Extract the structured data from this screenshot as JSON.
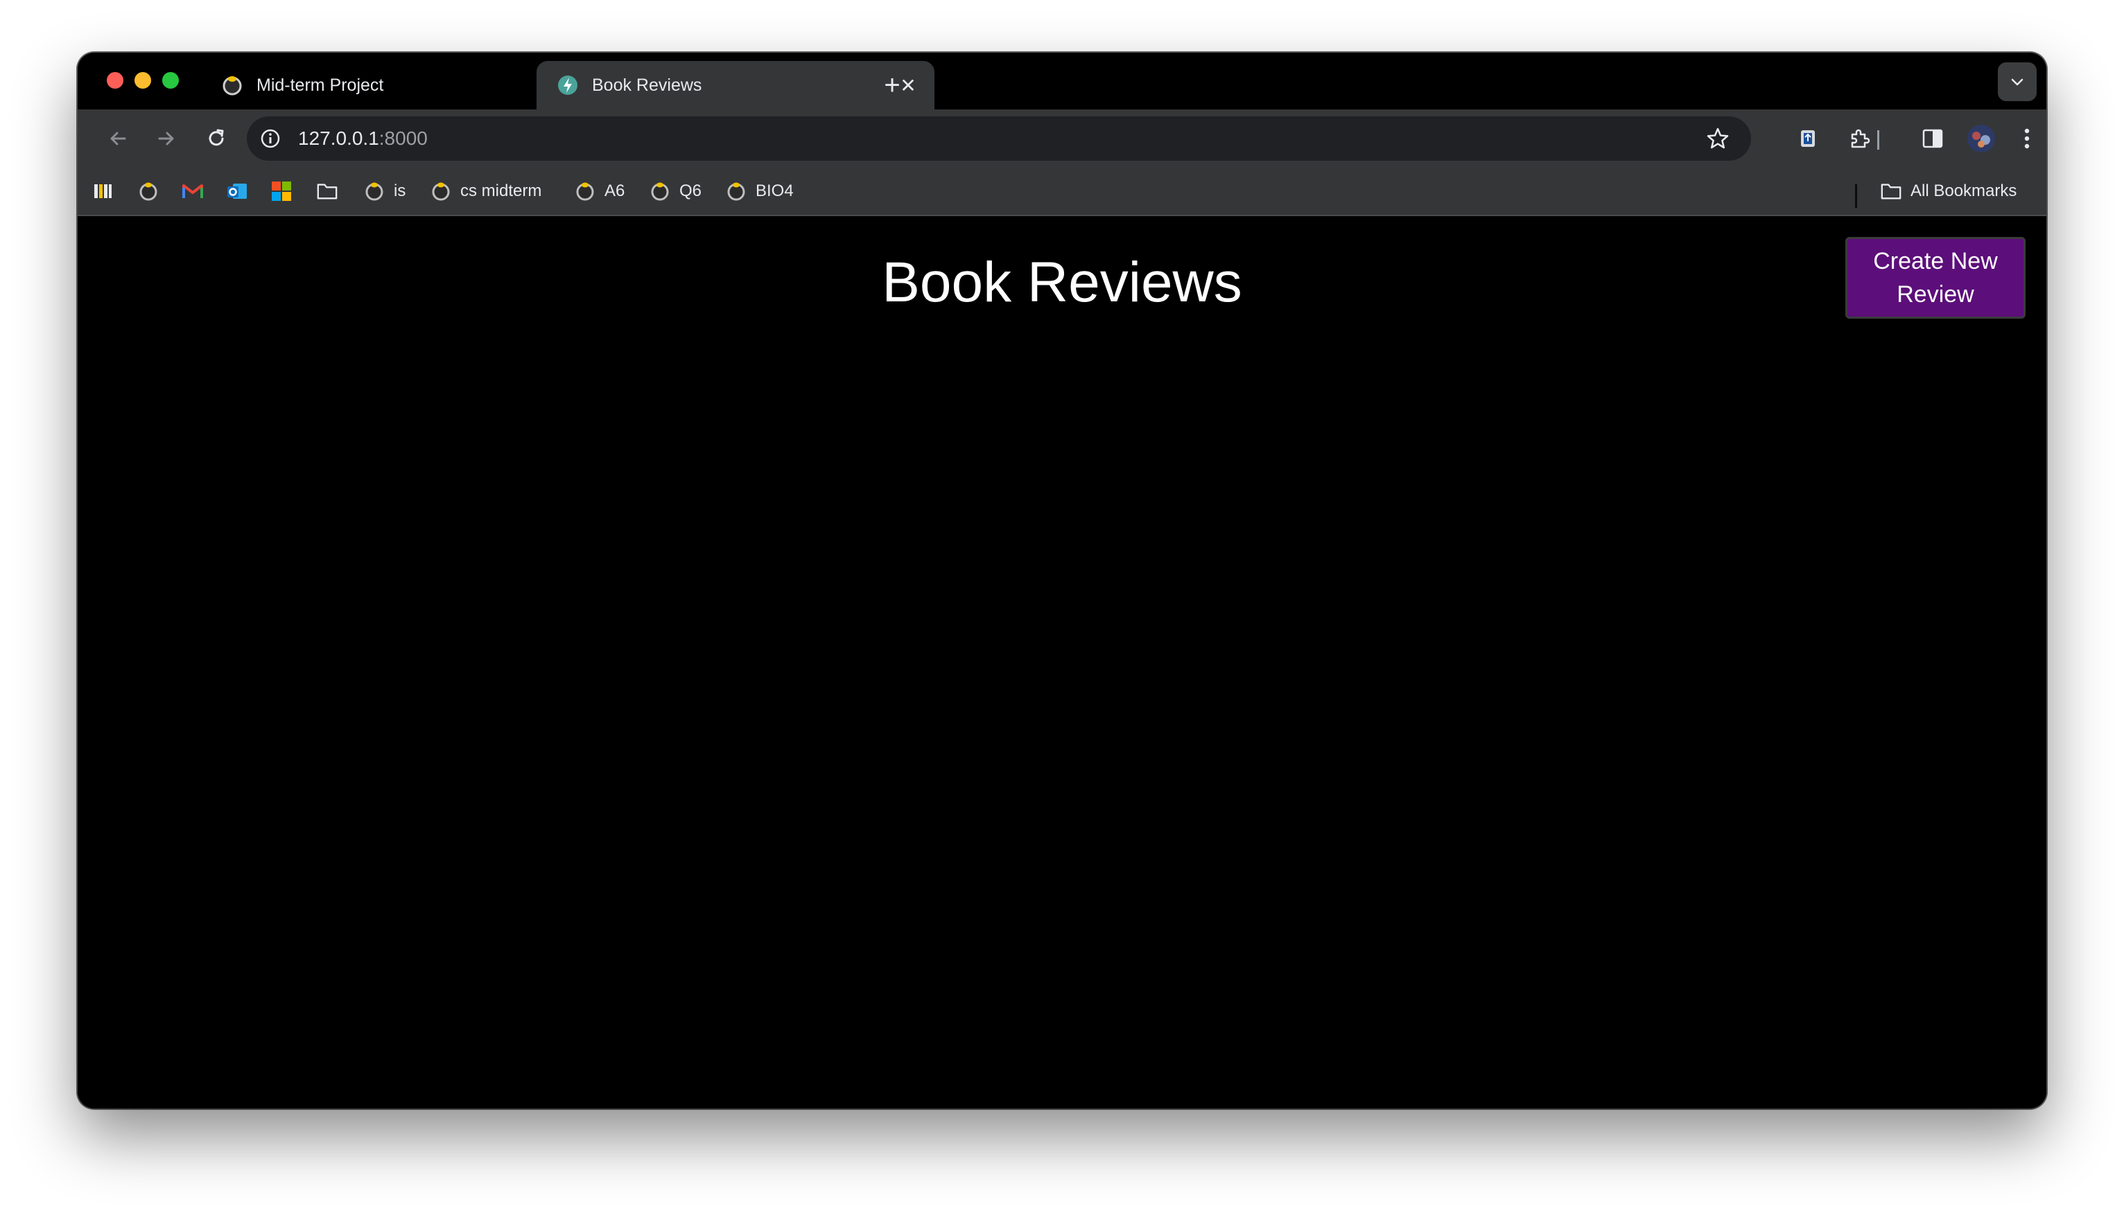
{
  "browser": {
    "tabs": [
      {
        "title": "Mid-term Project",
        "favicon": "owl-icon",
        "active": false
      },
      {
        "title": "Book Reviews",
        "favicon": "bolt-icon",
        "active": true
      }
    ],
    "address": {
      "host": "127.0.0.1",
      "port": ":8000"
    },
    "bookmarks": [
      {
        "label": "",
        "icon": "bars-logo-icon"
      },
      {
        "label": "",
        "icon": "owl-icon"
      },
      {
        "label": "",
        "icon": "gmail-icon"
      },
      {
        "label": "",
        "icon": "outlook-icon"
      },
      {
        "label": "",
        "icon": "microsoft-icon"
      },
      {
        "label": "",
        "icon": "folder-icon"
      },
      {
        "label": "is",
        "icon": "owl-icon"
      },
      {
        "label": "cs midterm",
        "icon": "owl-icon"
      },
      {
        "label": "A6",
        "icon": "owl-icon"
      },
      {
        "label": "Q6",
        "icon": "owl-icon"
      },
      {
        "label": "BIO4",
        "icon": "owl-icon"
      }
    ],
    "all_bookmarks_label": "All Bookmarks"
  },
  "page": {
    "title": "Book Reviews",
    "create_button_label": "Create New Review"
  },
  "colors": {
    "page_background": "#000000",
    "button_background": "#5c0f7a",
    "chrome_toolbar": "#353638",
    "tabstrip": "#000000"
  }
}
